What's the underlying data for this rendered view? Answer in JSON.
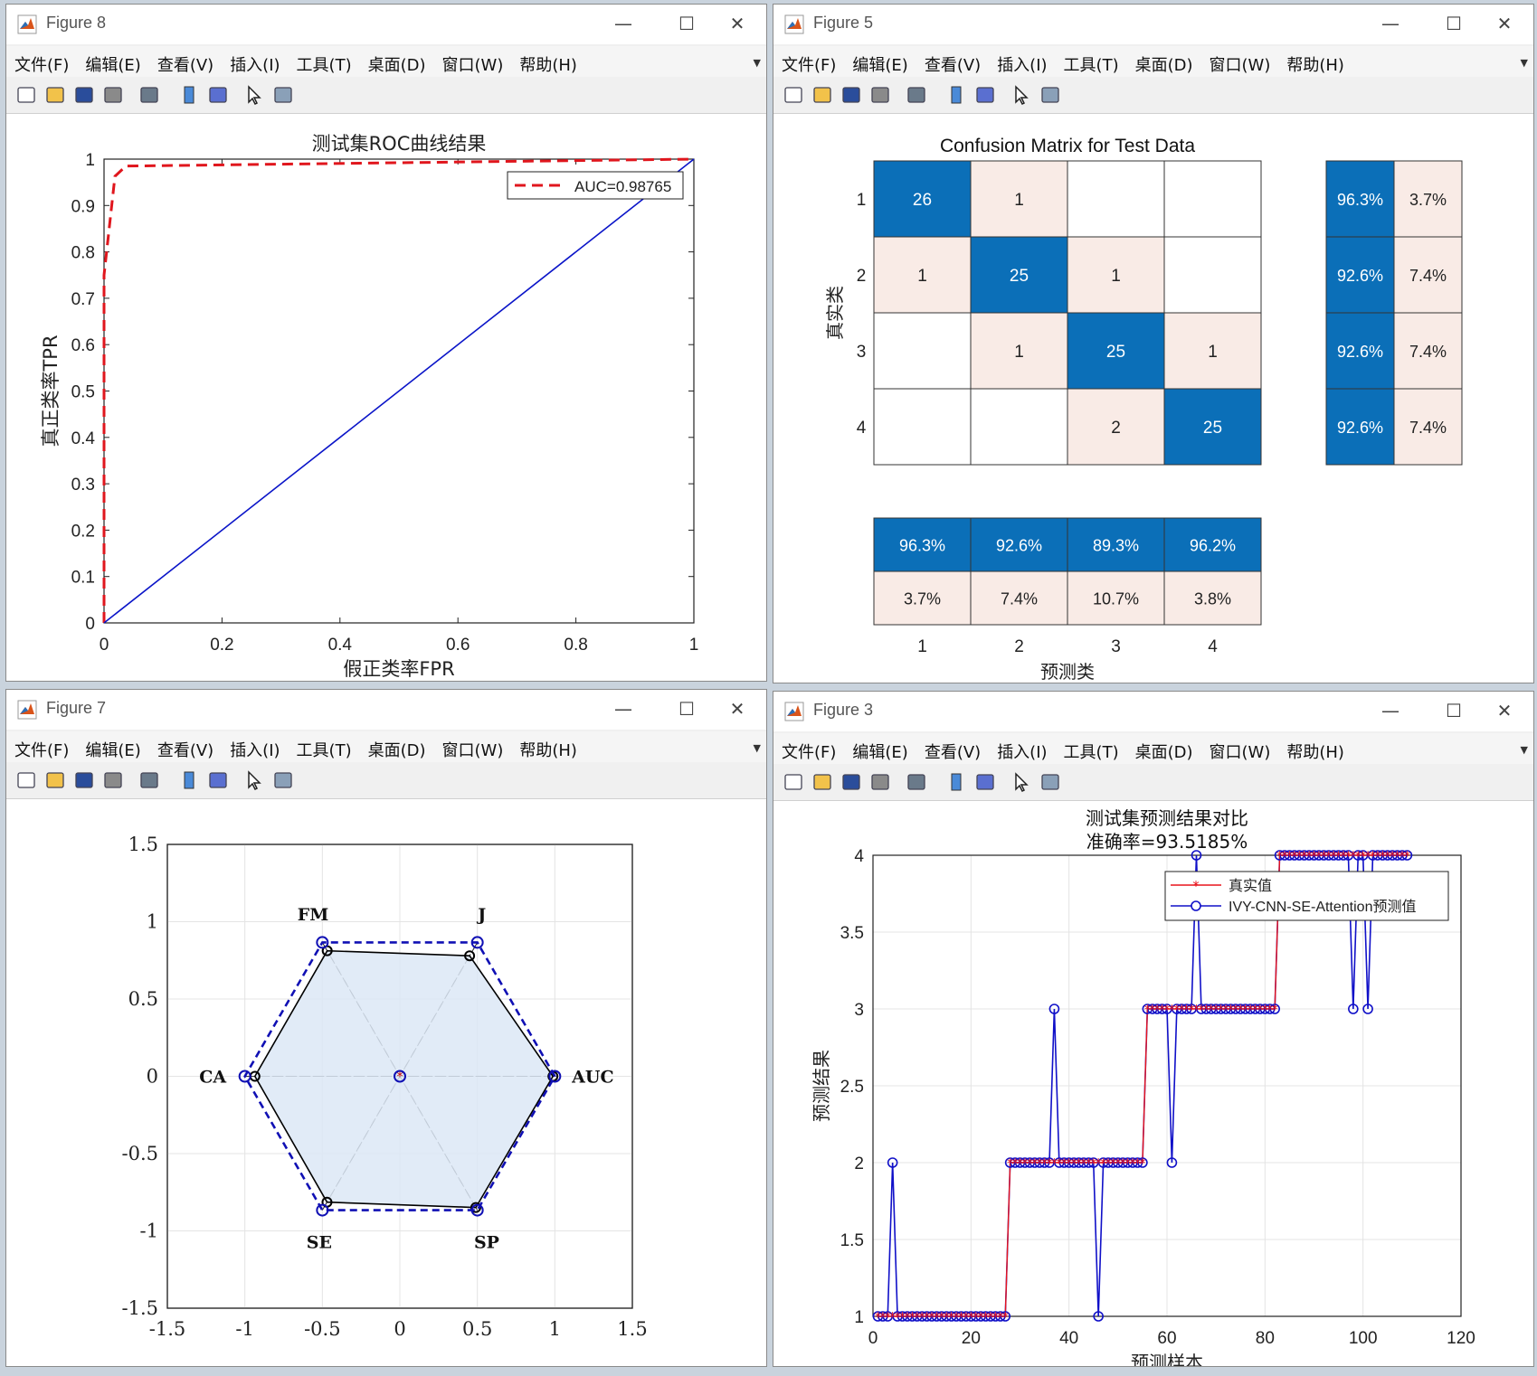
{
  "menus": [
    "文件(F)",
    "编辑(E)",
    "查看(V)",
    "插入(I)",
    "工具(T)",
    "桌面(D)",
    "窗口(W)",
    "帮助(H)"
  ],
  "window_controls": {
    "minimize": "—",
    "maximize": "☐",
    "close": "✕"
  },
  "fig8": {
    "window_title": "Figure 8",
    "chart_data": {
      "type": "line",
      "title": "测试集ROC曲线结果",
      "xlabel": "假正类率FPR",
      "ylabel": "真正类率TPR",
      "xlim": [
        0,
        1
      ],
      "ylim": [
        0,
        1
      ],
      "xticks": [
        "0",
        "0.2",
        "0.4",
        "0.6",
        "0.8",
        "1"
      ],
      "yticks": [
        "0",
        "0.1",
        "0.2",
        "0.3",
        "0.4",
        "0.5",
        "0.6",
        "0.7",
        "0.8",
        "0.9",
        "1"
      ],
      "legend_position": "top-right",
      "series": [
        {
          "name": "AUC=0.98765",
          "color": "#e0161d",
          "style": "dashed",
          "x": [
            0,
            0,
            0.0185,
            0.037,
            1
          ],
          "y": [
            0,
            0.75,
            0.963,
            0.985,
            1
          ]
        },
        {
          "name": "",
          "color": "#0a14c8",
          "style": "solid",
          "x": [
            0,
            1
          ],
          "y": [
            0,
            1
          ]
        }
      ]
    }
  },
  "fig5": {
    "window_title": "Figure 5",
    "chart_data": {
      "type": "heatmap",
      "title": "Confusion Matrix for Test Data",
      "xlabel": "预测类",
      "ylabel": "真实类",
      "classes": [
        "1",
        "2",
        "3",
        "4"
      ],
      "matrix": [
        [
          26,
          1,
          0,
          0
        ],
        [
          1,
          25,
          1,
          0
        ],
        [
          0,
          1,
          25,
          1
        ],
        [
          0,
          0,
          2,
          25
        ]
      ],
      "row_summary": [
        [
          "96.3%",
          "3.7%"
        ],
        [
          "92.6%",
          "7.4%"
        ],
        [
          "92.6%",
          "7.4%"
        ],
        [
          "92.6%",
          "7.4%"
        ]
      ],
      "col_summary": [
        [
          "96.3%",
          "3.7%"
        ],
        [
          "92.6%",
          "7.4%"
        ],
        [
          "89.3%",
          "10.7%"
        ],
        [
          "96.2%",
          "3.8%"
        ]
      ],
      "colors": {
        "diag": "#0b6fb8",
        "diag_text": "#ffffff",
        "offdiag": "#f9ebe6",
        "text": "#222222"
      }
    }
  },
  "fig7": {
    "window_title": "Figure 7",
    "chart_data": {
      "type": "radar",
      "axes": [
        "AUC",
        "J",
        "FM",
        "CA",
        "SE",
        "SP"
      ],
      "xlim": [
        -1.5,
        1.5
      ],
      "ylim": [
        -1.5,
        1.5
      ],
      "xticks": [
        "-1.5",
        "-1",
        "-0.5",
        "0",
        "0.5",
        "1",
        "1.5"
      ],
      "yticks": [
        "-1.5",
        "-1",
        "-0.5",
        "0",
        "0.5",
        "1",
        "1.5"
      ],
      "series": [
        {
          "name": "",
          "color": "#000000",
          "style": "solid",
          "fill": "#dce8f6",
          "values": [
            0.98765,
            0.9,
            0.9375,
            0.935,
            0.94,
            0.98
          ]
        },
        {
          "name": "",
          "color": "#1010b4",
          "style": "dashed",
          "values": [
            1,
            1,
            1,
            1,
            1,
            1
          ]
        }
      ]
    }
  },
  "fig3": {
    "window_title": "Figure 3",
    "chart_data": {
      "type": "line",
      "title": "测试集预测结果对比",
      "subtitle": "准确率=93.5185%",
      "xlabel": "预测样本",
      "ylabel": "预测结果",
      "xlim": [
        0,
        120
      ],
      "ylim": [
        1,
        4
      ],
      "xticks": [
        "0",
        "20",
        "40",
        "60",
        "80",
        "100",
        "120"
      ],
      "yticks": [
        "1",
        "1.5",
        "2",
        "2.5",
        "3",
        "3.5",
        "4"
      ],
      "legend_position": "top-right",
      "series": [
        {
          "name": "真实值",
          "color": "#e8141c",
          "marker": "*",
          "values": [
            1,
            1,
            1,
            1,
            1,
            1,
            1,
            1,
            1,
            1,
            1,
            1,
            1,
            1,
            1,
            1,
            1,
            1,
            1,
            1,
            1,
            1,
            1,
            1,
            1,
            1,
            1,
            2,
            2,
            2,
            2,
            2,
            2,
            2,
            2,
            2,
            2,
            2,
            2,
            2,
            2,
            2,
            2,
            2,
            2,
            2,
            2,
            2,
            2,
            2,
            2,
            2,
            2,
            2,
            2,
            3,
            3,
            3,
            3,
            3,
            3,
            3,
            3,
            3,
            3,
            3,
            3,
            3,
            3,
            3,
            3,
            3,
            3,
            3,
            3,
            3,
            3,
            3,
            3,
            3,
            3,
            3,
            4,
            4,
            4,
            4,
            4,
            4,
            4,
            4,
            4,
            4,
            4,
            4,
            4,
            4,
            4,
            4,
            4,
            4,
            4,
            4,
            4,
            4,
            4,
            4,
            4,
            4,
            4
          ]
        },
        {
          "name": "IVY-CNN-SE-Attention预测值",
          "color": "#1010c8",
          "marker": "o",
          "values": [
            1,
            1,
            1,
            2,
            1,
            1,
            1,
            1,
            1,
            1,
            1,
            1,
            1,
            1,
            1,
            1,
            1,
            1,
            1,
            1,
            1,
            1,
            1,
            1,
            1,
            1,
            1,
            2,
            2,
            2,
            2,
            2,
            2,
            2,
            2,
            2,
            3,
            2,
            2,
            2,
            2,
            2,
            2,
            2,
            2,
            1,
            2,
            2,
            2,
            2,
            2,
            2,
            2,
            2,
            2,
            3,
            3,
            3,
            3,
            3,
            2,
            3,
            3,
            3,
            3,
            4,
            3,
            3,
            3,
            3,
            3,
            3,
            3,
            3,
            3,
            3,
            3,
            3,
            3,
            3,
            3,
            3,
            4,
            4,
            4,
            4,
            4,
            4,
            4,
            4,
            4,
            4,
            4,
            4,
            4,
            4,
            4,
            3,
            4,
            4,
            3,
            4,
            4,
            4,
            4,
            4,
            4,
            4,
            4
          ]
        }
      ]
    }
  }
}
